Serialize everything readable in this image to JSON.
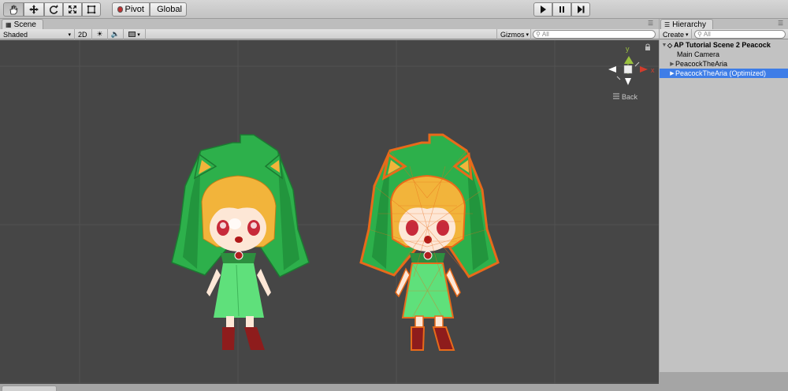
{
  "toolbar": {
    "tools": [
      {
        "name": "hand-tool",
        "active": true
      },
      {
        "name": "move-tool",
        "active": false
      },
      {
        "name": "rotate-tool",
        "active": false
      },
      {
        "name": "scale-tool",
        "active": false
      },
      {
        "name": "rect-tool",
        "active": false
      }
    ],
    "pivot_label": "Pivot",
    "global_label": "Global",
    "pivot_color": "#c03030",
    "global_color": "#555555"
  },
  "scene": {
    "tab_label": "Scene",
    "draw_mode": "Shaded",
    "mode_2d": "2D",
    "gizmos_label": "Gizmos",
    "search_placeholder": "All",
    "back_label": "Back",
    "gizmo_y": "y",
    "gizmo_x": "x"
  },
  "hierarchy": {
    "tab_label": "Hierarchy",
    "create_label": "Create",
    "search_placeholder": "All",
    "items": [
      {
        "label": "AP Tutorial Scene 2 Peacock",
        "bold": true,
        "expanded": true,
        "indent": 0,
        "selected": false
      },
      {
        "label": "Main Camera",
        "indent": 1,
        "selected": false
      },
      {
        "label": "PeacockTheAria",
        "indent": 1,
        "selected": false
      },
      {
        "label": "PeacockTheAria (Optimized)",
        "indent": 1,
        "selected": true
      }
    ]
  },
  "colors": {
    "viewport_bg": "#464646",
    "cloak_green": "#2db04b",
    "outline_orange": "#e86a1a",
    "selection_blue": "#3e7de7"
  }
}
